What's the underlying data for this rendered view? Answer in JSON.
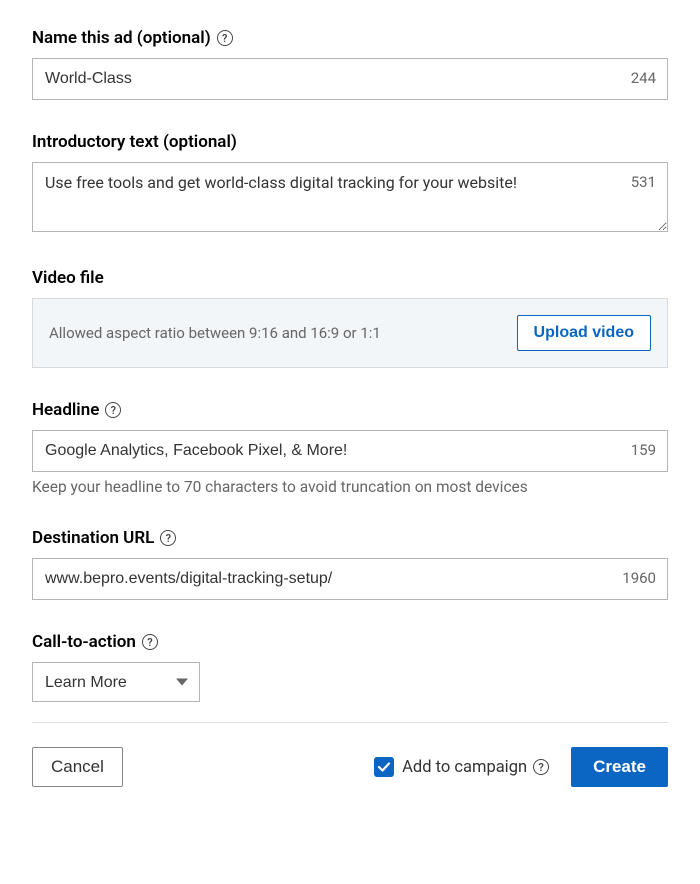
{
  "adName": {
    "label": "Name this ad (optional)",
    "value": "World-Class",
    "count": "244"
  },
  "introText": {
    "label": "Introductory text (optional)",
    "value": "Use free tools and get world-class digital tracking for your website!",
    "count": "531"
  },
  "videoFile": {
    "label": "Video file",
    "hint": "Allowed aspect ratio between 9:16 and 16:9 or 1:1",
    "buttonLabel": "Upload video"
  },
  "headline": {
    "label": "Headline",
    "value": "Google Analytics, Facebook Pixel, & More!",
    "count": "159",
    "helper": "Keep your headline to 70 characters to avoid truncation on most devices"
  },
  "destinationUrl": {
    "label": "Destination URL",
    "value": "www.bepro.events/digital-tracking-setup/",
    "count": "1960"
  },
  "cta": {
    "label": "Call-to-action",
    "selected": "Learn More"
  },
  "footer": {
    "cancel": "Cancel",
    "addToCampaign": "Add to campaign",
    "create": "Create"
  }
}
